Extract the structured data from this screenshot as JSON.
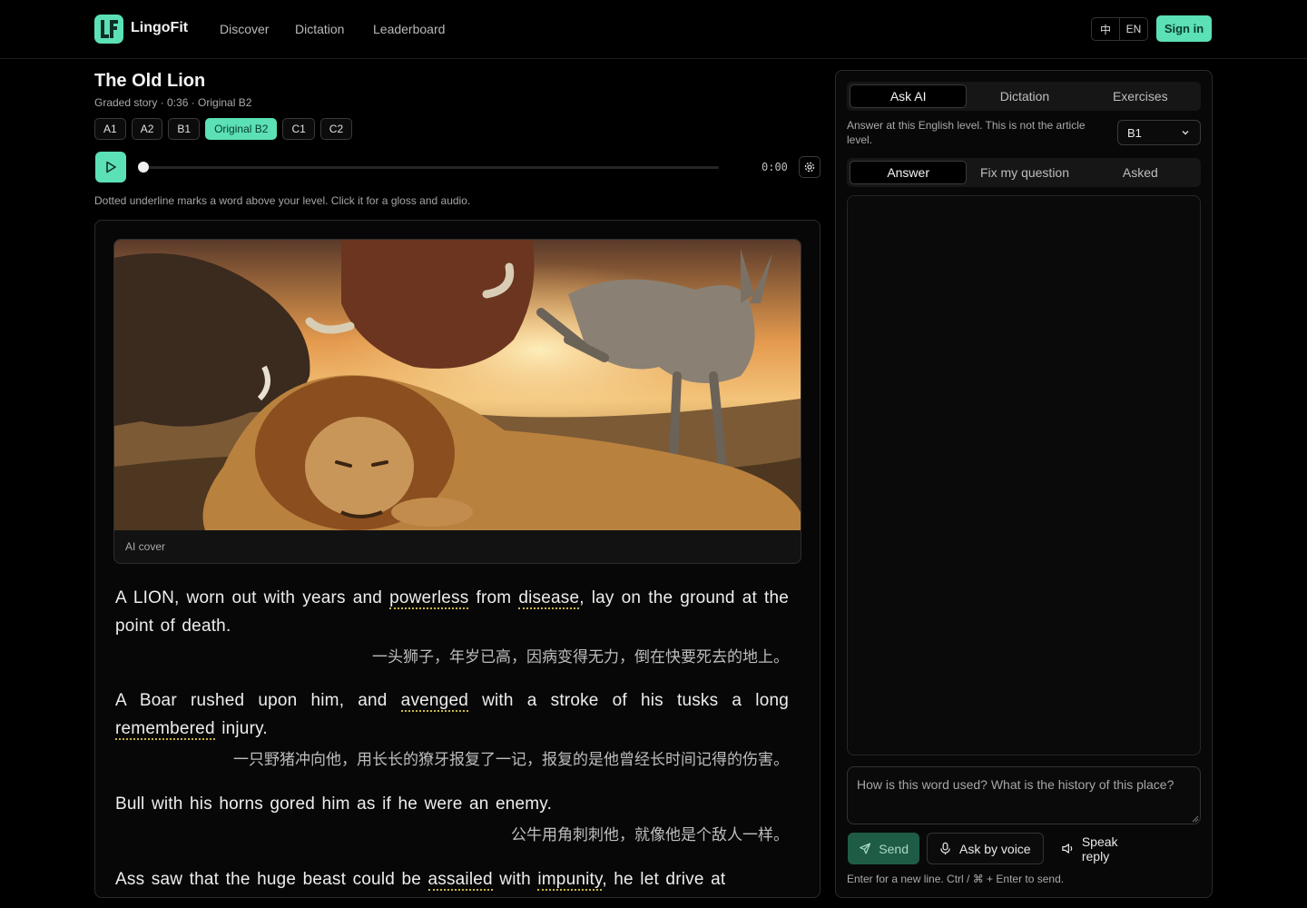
{
  "app": {
    "brand": "LingoFit",
    "logo_text": "LF",
    "nav": [
      "Discover",
      "Dictation",
      "Leaderboard"
    ],
    "lang_zh": "中",
    "lang_en": "EN",
    "sign_in": "Sign in"
  },
  "story": {
    "title": "The Old Lion",
    "meta": "Graded story · 0:36 · Original B2",
    "levels": [
      "A1",
      "A2",
      "B1",
      "Original B2",
      "C1",
      "C2"
    ],
    "active_level": "Original B2",
    "time": "0:00",
    "progress": 0,
    "hint": "Dotted underline marks a word above your level. Click it for a gloss and audio.",
    "cover_caption": "AI cover",
    "paragraphs": [
      {
        "en_parts": [
          "A LION, worn out with years and ",
          "powerless",
          " from ",
          "disease",
          ", lay on the ground at the point of death."
        ],
        "zh": "一头狮子，年岁已高，因病变得无力，倒在快要死去的地上。"
      },
      {
        "en_parts": [
          "A Boar rushed upon him, and ",
          "avenged",
          " with a stroke of his tusks a long ",
          "remembered",
          " injury."
        ],
        "zh": "一只野猪冲向他，用长长的獠牙报复了一记，报复的是他曾经长时间记得的伤害。"
      },
      {
        "en_parts": [
          "Bull with his horns gored him as if he were an enemy."
        ],
        "zh": "公牛用角刺刺他，就像他是个敌人一样。"
      },
      {
        "en_parts": [
          "Ass saw that the huge beast could be ",
          "assailed",
          " with ",
          "impunity",
          ", he let drive at"
        ],
        "zh": ""
      }
    ]
  },
  "panel": {
    "tabs": [
      "Ask AI",
      "Dictation",
      "Exercises"
    ],
    "active_tab": "Ask AI",
    "level_note": "Answer at this English level. This is not the article level.",
    "level_value": "B1",
    "subtabs": [
      "Answer",
      "Fix my question",
      "Asked"
    ],
    "active_subtab": "Answer",
    "question_placeholder": "How is this word used? What is the history of this place?",
    "send": "Send",
    "ask_voice": "Ask by voice",
    "speak_reply": "Speak reply",
    "footer": "Enter for a new line. Ctrl / ⌘ + Enter to send."
  },
  "colors": {
    "accent": "#5ce0b5",
    "background": "#000000",
    "hard_word_underline": "#c9b64a"
  }
}
